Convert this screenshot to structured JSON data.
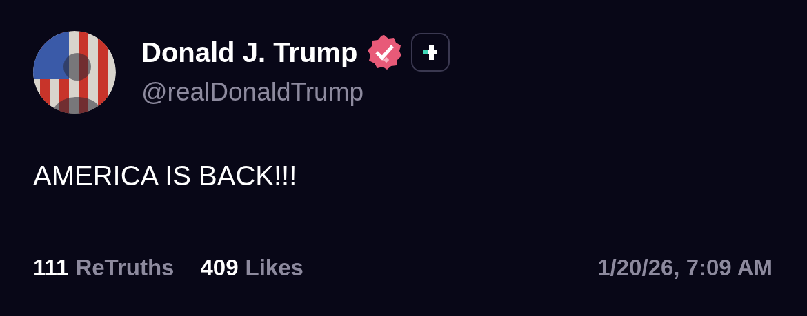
{
  "post": {
    "author": {
      "name": "Donald J. Trump",
      "handle": "@realDonaldTrump",
      "verified": true
    },
    "text": "AMERICA IS BACK!!!",
    "stats": [
      {
        "count": "111",
        "label": "ReTruths"
      },
      {
        "count": "409",
        "label": "Likes"
      }
    ],
    "timestamp": "1/20/26, 7:09 AM"
  }
}
